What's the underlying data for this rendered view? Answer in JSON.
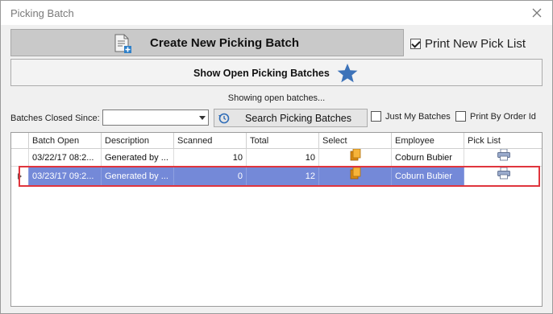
{
  "window": {
    "title": "Picking Batch"
  },
  "toolbar": {
    "create_label": "Create New Picking Batch",
    "print_new_label": "Print New Pick List",
    "print_new_checked": true,
    "show_open_label": "Show Open Picking Batches"
  },
  "status_text": "Showing open batches...",
  "filter": {
    "closed_since_label": "Batches Closed Since:",
    "closed_since_value": "",
    "search_label": "Search Picking Batches",
    "just_my_label": "Just My Batches",
    "just_my_checked": false,
    "by_order_label": "Print By Order Id",
    "by_order_checked": false
  },
  "grid": {
    "columns": [
      "Batch Open",
      "Description",
      "Scanned",
      "Total",
      "Select",
      "Employee",
      "Pick List"
    ],
    "rows": [
      {
        "batch_open": "03/22/17 08:2...",
        "description": "Generated by ...",
        "scanned": "10",
        "total": "10",
        "employee": "Coburn Bubier",
        "selected": false
      },
      {
        "batch_open": "03/23/17 09:2...",
        "description": "Generated by ...",
        "scanned": "0",
        "total": "12",
        "employee": "Coburn Bubier",
        "selected": true
      }
    ]
  },
  "icons": {
    "close": "close-icon",
    "create": "document-add-icon",
    "star": "star-icon",
    "search": "history-search-icon",
    "select": "copy-documents-icon",
    "print": "printer-icon",
    "row_indicator": "caret-right-icon"
  },
  "colors": {
    "selected_row": "#7489d8",
    "highlight_outline": "#e0353d",
    "star": "#3d73b9"
  }
}
